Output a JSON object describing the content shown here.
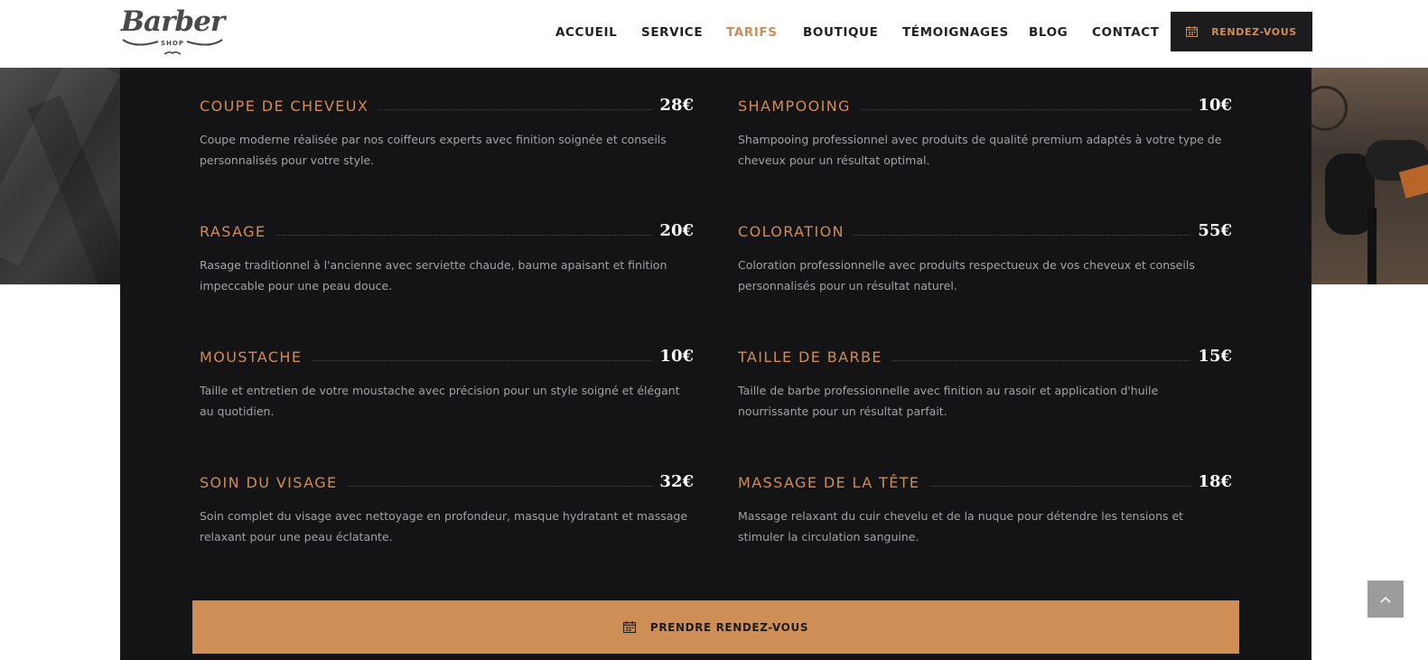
{
  "brand": {
    "logo_script": "Barber",
    "logo_sub": "SHOP"
  },
  "nav": {
    "items": [
      {
        "label": "ACCUEIL"
      },
      {
        "label": "SERVICE"
      },
      {
        "label": "TARIFS",
        "active": true
      },
      {
        "label": "BOUTIQUE"
      },
      {
        "label": "TÉMOIGNAGES"
      },
      {
        "label": "BLOG"
      },
      {
        "label": "CONTACT"
      }
    ],
    "cta_label": "RENDEZ-VOUS",
    "cta_icon": "calendar-icon"
  },
  "pricing": {
    "items": [
      {
        "name": "COUPE DE CHEVEUX",
        "price": "28€",
        "desc": "Coupe moderne réalisée par nos coiffeurs experts avec finition soignée et conseils personnalisés pour votre style."
      },
      {
        "name": "SHAMPOOING",
        "price": "10€",
        "desc": "Shampooing professionnel avec produits de qualité premium adaptés à votre type de cheveux pour un résultat optimal."
      },
      {
        "name": "RASAGE",
        "price": "20€",
        "desc": "Rasage traditionnel à l'ancienne avec serviette chaude, baume apaisant et finition impeccable pour une peau douce."
      },
      {
        "name": "COLORATION",
        "price": "55€",
        "desc": "Coloration professionnelle avec produits respectueux de vos cheveux et conseils personnalisés pour un résultat naturel."
      },
      {
        "name": "MOUSTACHE",
        "price": "10€",
        "desc": "Taille et entretien de votre moustache avec précision pour un style soigné et élégant au quotidien."
      },
      {
        "name": "TAILLE DE BARBE",
        "price": "15€",
        "desc": "Taille de barbe professionnelle avec finition au rasoir et application d'huile nourrissante pour un résultat parfait."
      },
      {
        "name": "SOIN DU VISAGE",
        "price": "32€",
        "desc": "Soin complet du visage avec nettoyage en profondeur, masque hydratant et massage relaxant pour une peau éclatante."
      },
      {
        "name": "MASSAGE DE LA TÊTE",
        "price": "18€",
        "desc": "Massage relaxant du cuir chevelu et de la nuque pour détendre les tensions et stimuler la circulation sanguine."
      }
    ],
    "book_label": "PRENDRE RENDEZ-VOUS",
    "book_icon": "calendar-icon"
  },
  "scroll_top_icon": "chevron-up-icon",
  "colors": {
    "accent": "#cf8e56",
    "panel": "#141416",
    "dark_button": "#1c1b1d",
    "nav_text": "#222222"
  }
}
